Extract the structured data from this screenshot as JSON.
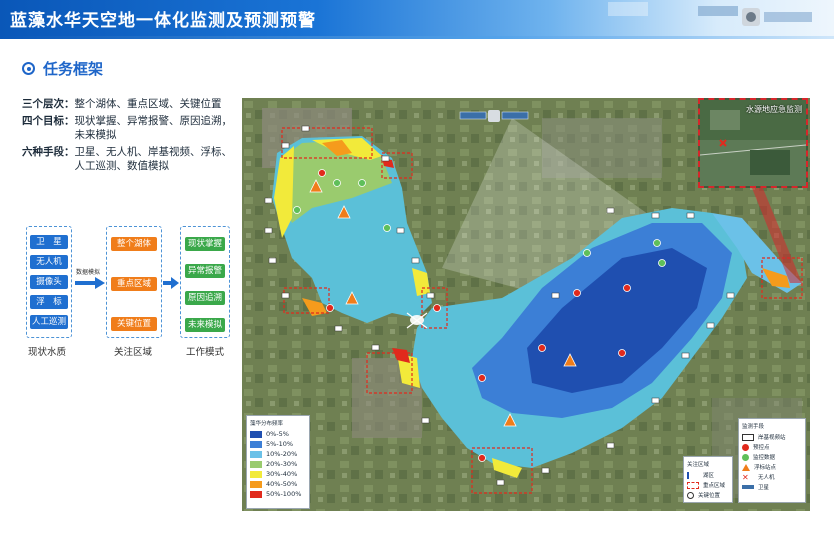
{
  "header": {
    "title": "蓝藻水华天空地一体化监测及预测预警"
  },
  "section": {
    "title": "任务框架"
  },
  "description": [
    {
      "label": "三个层次：",
      "text": "整个湖体、重点区域、关键位置"
    },
    {
      "label": "四个目标：",
      "text": "现状掌握、异常报警、原因追溯，未来模拟"
    },
    {
      "label": "六种手段：",
      "text": "卫星、无人机、岸基视频、浮标、人工巡测、数值模拟"
    }
  ],
  "flow": {
    "sources": [
      "卫　星",
      "无人机",
      "摄像头",
      "浮　标",
      "人工巡测"
    ],
    "arrow_label": "数据模拟",
    "areas": [
      "整个湖体",
      "重点区域",
      "关键位置"
    ],
    "modes": [
      "现状掌握",
      "异常报警",
      "原因追溯",
      "未来模拟"
    ],
    "captions": [
      "现状水质",
      "关注区域",
      "工作模式"
    ]
  },
  "map": {
    "inset_title": "水源地应急监测",
    "density_legend": {
      "title": "藻华分布频率",
      "items": [
        {
          "label": "0%-5%",
          "color": "#1f4fb0"
        },
        {
          "label": "5%-10%",
          "color": "#3c7fd6"
        },
        {
          "label": "10%-20%",
          "color": "#6bc1e8"
        },
        {
          "label": "20%-30%",
          "color": "#9acb6e"
        },
        {
          "label": "30%-40%",
          "color": "#f2ea3a"
        },
        {
          "label": "40%-50%",
          "color": "#f59b1c"
        },
        {
          "label": "50%-100%",
          "color": "#e12a1d"
        }
      ]
    },
    "area_legend": {
      "title": "关注区域",
      "items": [
        "湖区",
        "重点区域",
        "关键位置"
      ]
    },
    "monitor_legend": {
      "title": "监测手段",
      "items": [
        "岸基视频站",
        "预控点",
        "监控数据",
        "浮标站点",
        "无人机",
        "卫星"
      ]
    }
  },
  "colors": {
    "brand_blue": "#1f66c9",
    "source_blue": "#1f6fd0",
    "area_orange": "#f07d1a",
    "mode_green": "#3aa84a"
  }
}
